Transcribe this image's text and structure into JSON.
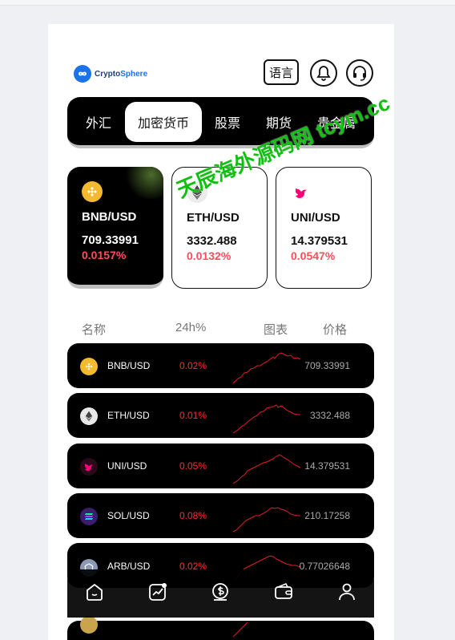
{
  "brand": {
    "name_a": "Crypto",
    "name_b": "Sphere",
    "brand_color": "#1a73e8"
  },
  "header": {
    "language_label": "语言",
    "icons": [
      "bell-icon",
      "headset-icon"
    ]
  },
  "tabs": [
    {
      "label": "外汇",
      "active": false
    },
    {
      "label": "加密货币",
      "active": true
    },
    {
      "label": "股票",
      "active": false
    },
    {
      "label": "期货",
      "active": false
    },
    {
      "label": "贵金属",
      "active": false
    }
  ],
  "featured": [
    {
      "pair": "BNB/USD",
      "price": "709.33991",
      "change": "0.0157%",
      "icon": "bnb-icon",
      "selected": true
    },
    {
      "pair": "ETH/USD",
      "price": "3332.488",
      "change": "0.0132%",
      "icon": "eth-icon",
      "selected": false
    },
    {
      "pair": "UNI/USD",
      "price": "14.379531",
      "change": "0.0547%",
      "icon": "uni-icon",
      "selected": false
    }
  ],
  "list_header": {
    "name": "名称",
    "change": "24h%",
    "chart": "图表",
    "price": "价格"
  },
  "rows": [
    {
      "pair": "BNB/USD",
      "change": "0.02%",
      "price": "709.33991",
      "icon": "bnb-icon"
    },
    {
      "pair": "ETH/USD",
      "change": "0.01%",
      "price": "3332.488",
      "icon": "eth-icon"
    },
    {
      "pair": "UNI/USD",
      "change": "0.05%",
      "price": "14.379531",
      "icon": "uni-icon"
    },
    {
      "pair": "SOL/USD",
      "change": "0.08%",
      "price": "210.17258",
      "icon": "sol-icon"
    },
    {
      "pair": "ARB/USD",
      "change": "0.02%",
      "price": "0.77026648",
      "icon": "arb-icon"
    }
  ],
  "bottom_nav": [
    {
      "icon": "home-icon",
      "active": false
    },
    {
      "icon": "market-chart-icon",
      "active": true
    },
    {
      "icon": "dollar-coin-icon",
      "active": false
    },
    {
      "icon": "wallet-icon",
      "active": false
    },
    {
      "icon": "user-icon",
      "active": false
    }
  ],
  "watermark": "天辰海外源码网 tcym.cc",
  "colors": {
    "positive_change": "#ff2d2d",
    "card_change": "#ff4d5a",
    "watermark": "#10c010"
  }
}
